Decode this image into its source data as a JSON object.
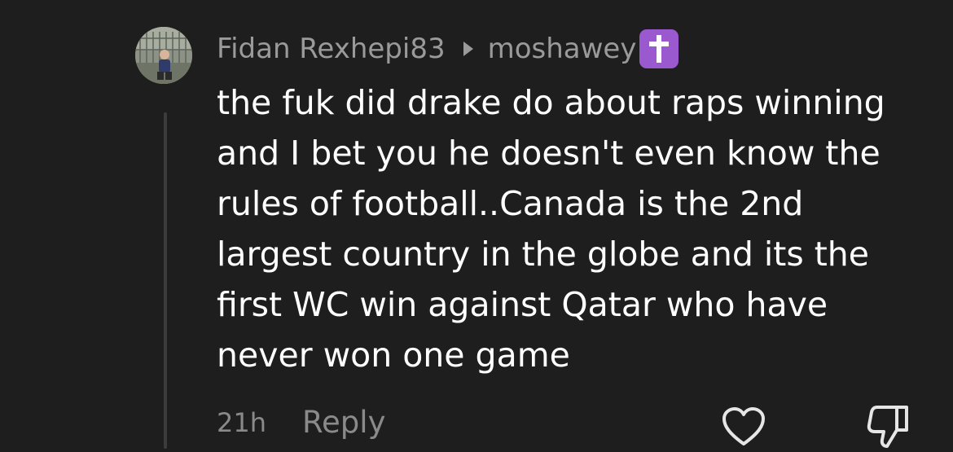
{
  "comment": {
    "author": "Fidan Rexhepi83",
    "reply_to": "moshawey",
    "reply_to_badge_icon": "latin-cross-emoji",
    "text": "the fuk did drake do about raps winning\nand I bet you he doesn't even know the\nrules of football..Canada is the 2nd\nlargest country in the globe and its the\nfirst WC win against Qatar who have\nnever won one game",
    "time": "21h",
    "reply_label": "Reply"
  },
  "icons": {
    "reply_arrow": "triangle-right-icon",
    "like": "heart-outline-icon",
    "dislike": "thumbs-down-outline-icon"
  },
  "colors": {
    "background": "#1e1e1e",
    "text_primary": "#ffffff",
    "text_secondary": "#9a9a9a",
    "badge": "#9b59d0"
  }
}
